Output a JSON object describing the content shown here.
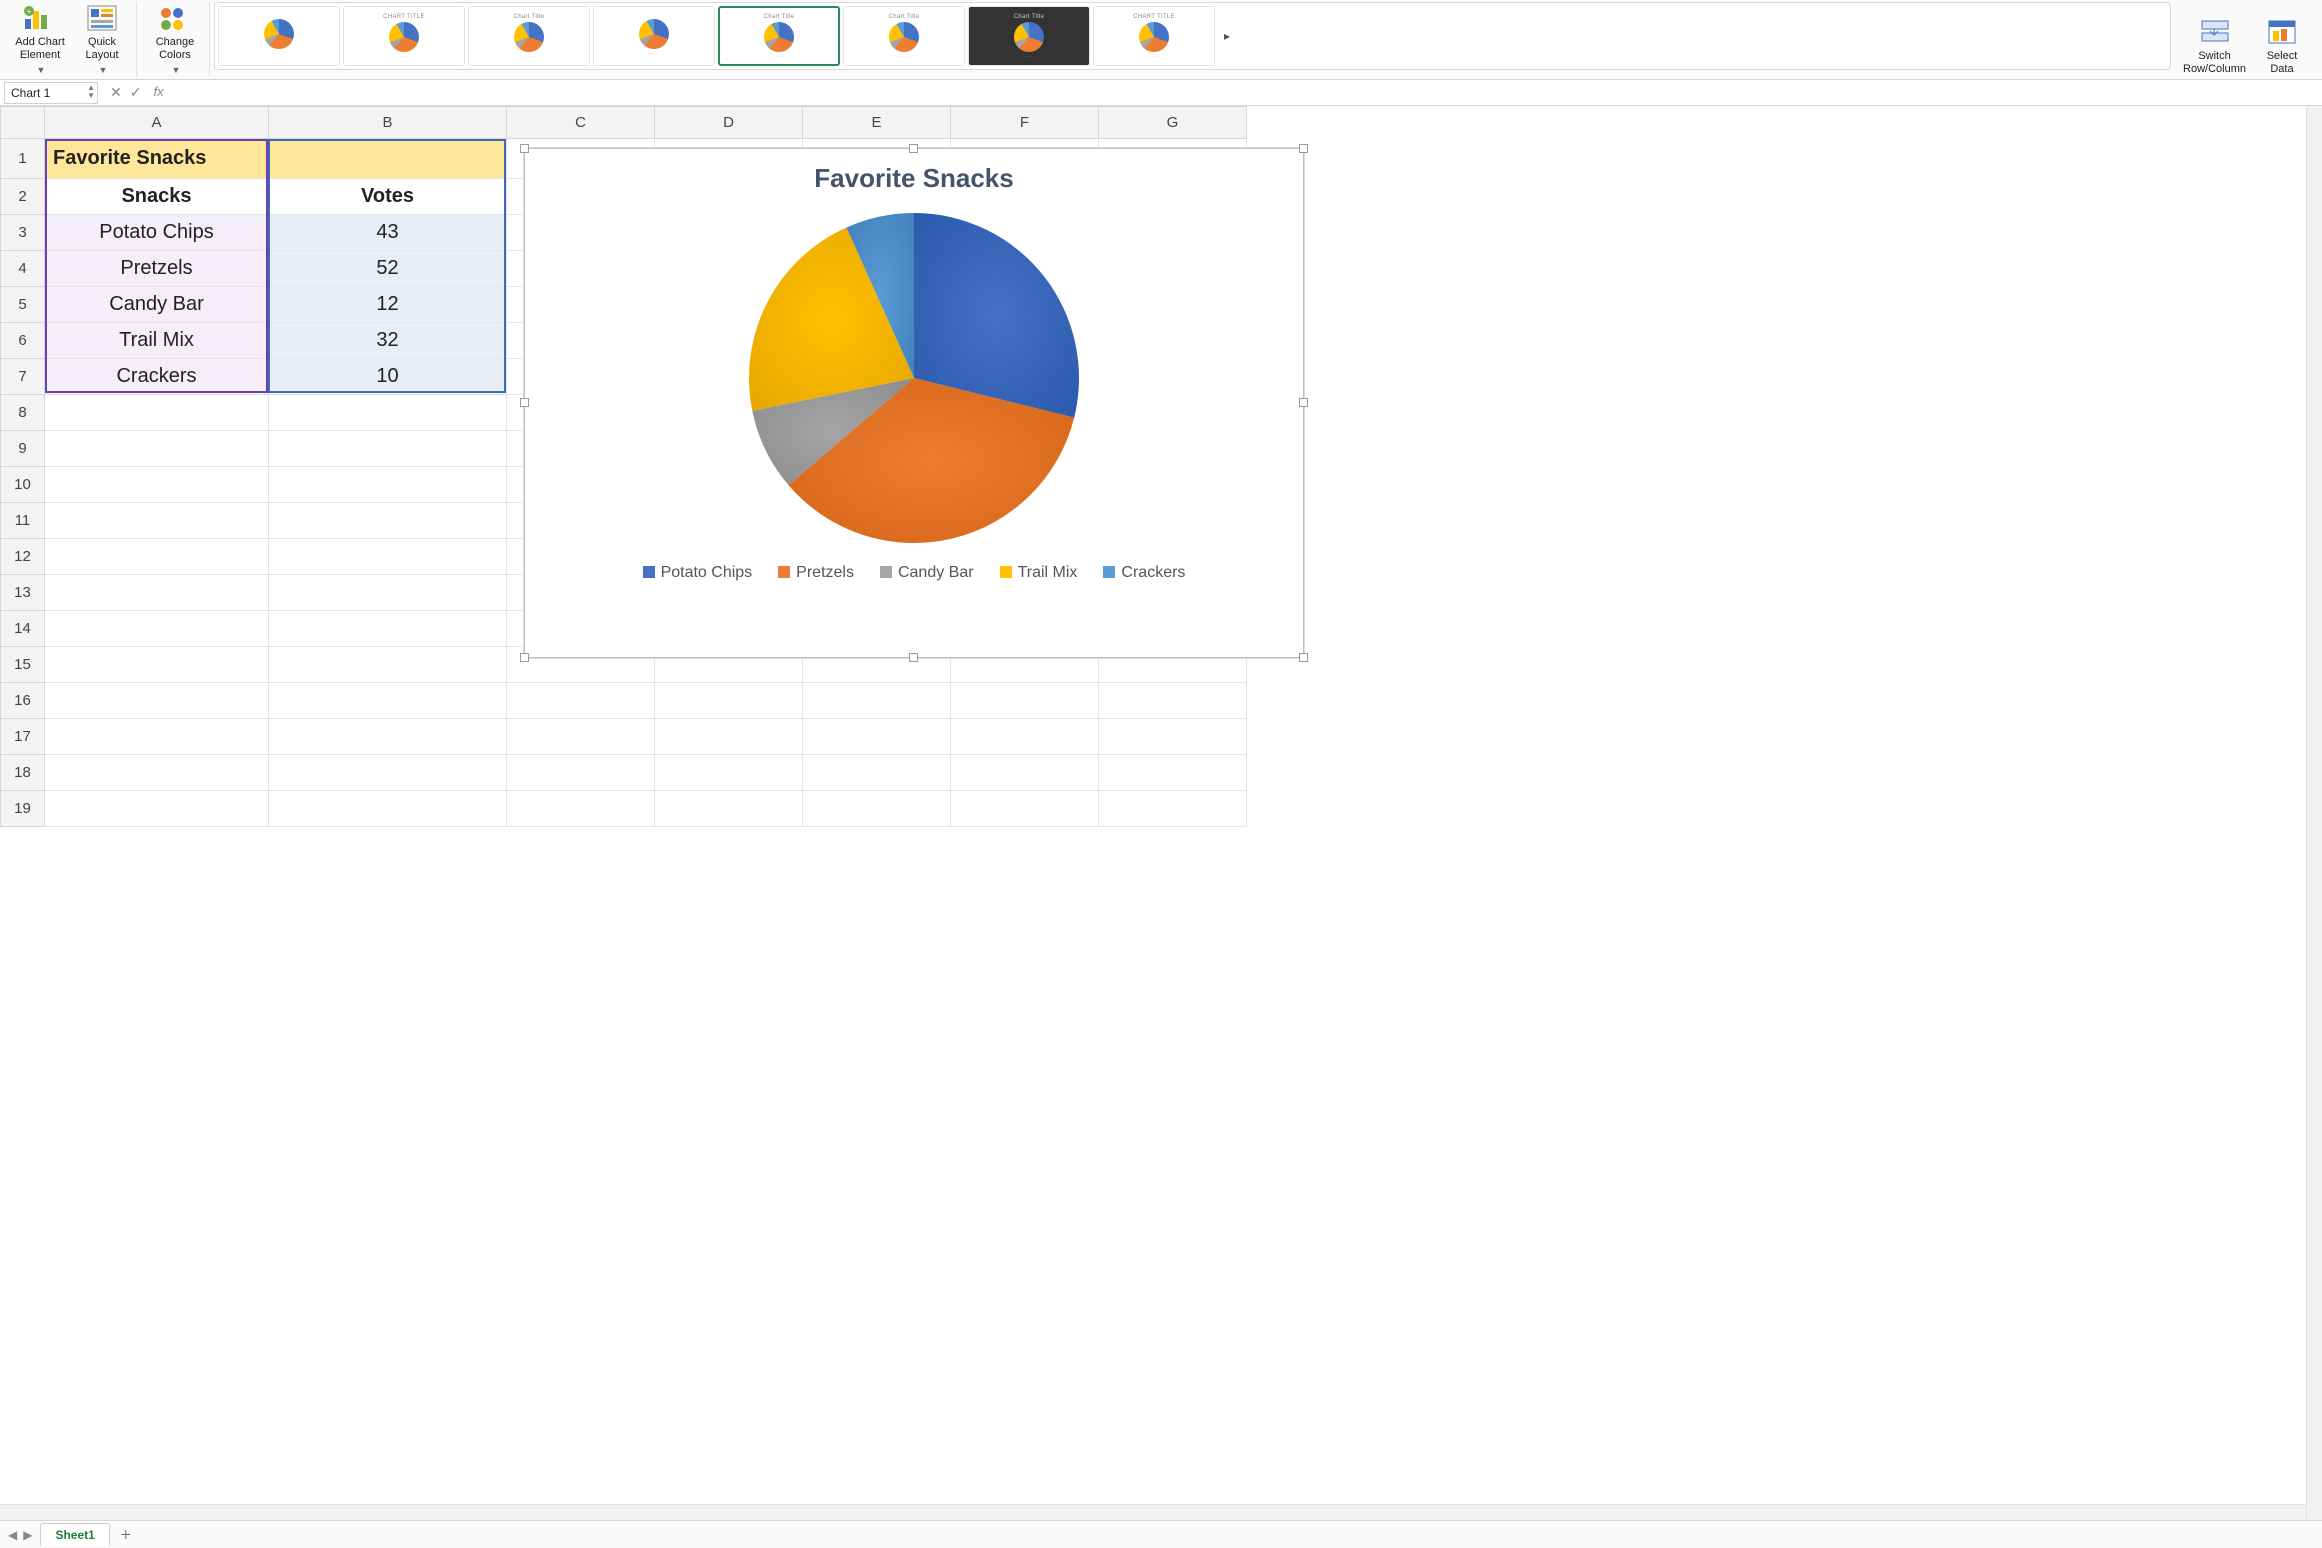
{
  "ribbon": {
    "add_chart_element": "Add Chart\nElement",
    "quick_layout": "Quick\nLayout",
    "change_colors": "Change\nColors",
    "switch_row_col": "Switch\nRow/Column",
    "select_data": "Select\nData",
    "style_thumbs": [
      {
        "title": "",
        "selected": false,
        "dark": false
      },
      {
        "title": "CHART TITLE",
        "selected": false,
        "dark": false
      },
      {
        "title": "Chart Title",
        "selected": false,
        "dark": false
      },
      {
        "title": "",
        "selected": false,
        "dark": false
      },
      {
        "title": "Chart Title",
        "selected": true,
        "dark": false
      },
      {
        "title": "Chart Title",
        "selected": false,
        "dark": false
      },
      {
        "title": "Chart Title",
        "selected": false,
        "dark": true
      },
      {
        "title": "CHART TITLE",
        "selected": false,
        "dark": false
      }
    ]
  },
  "namebox": "Chart 1",
  "fx_label": "fx",
  "columns": [
    "A",
    "B",
    "C",
    "D",
    "E",
    "F",
    "G"
  ],
  "rows": [
    "1",
    "2",
    "3",
    "4",
    "5",
    "6",
    "7",
    "8",
    "9",
    "10",
    "11",
    "12",
    "13",
    "14",
    "15",
    "16",
    "17",
    "18",
    "19"
  ],
  "cells": {
    "A1": "Favorite Snacks",
    "A2": "Snacks",
    "B2": "Votes",
    "A3": "Potato Chips",
    "B3": "43",
    "A4": "Pretzels",
    "B4": "52",
    "A5": "Candy Bar",
    "B5": "12",
    "A6": "Trail Mix",
    "B6": "32",
    "A7": "Crackers",
    "B7": "10"
  },
  "sheet_tab": "Sheet1",
  "chart_data": {
    "type": "pie",
    "title": "Favorite Snacks",
    "categories": [
      "Potato Chips",
      "Pretzels",
      "Candy Bar",
      "Trail Mix",
      "Crackers"
    ],
    "values": [
      43,
      52,
      12,
      32,
      10
    ],
    "colors": [
      "#4472c4",
      "#ed7d31",
      "#a5a5a5",
      "#ffc000",
      "#5b9bd5"
    ],
    "legend_position": "bottom"
  }
}
